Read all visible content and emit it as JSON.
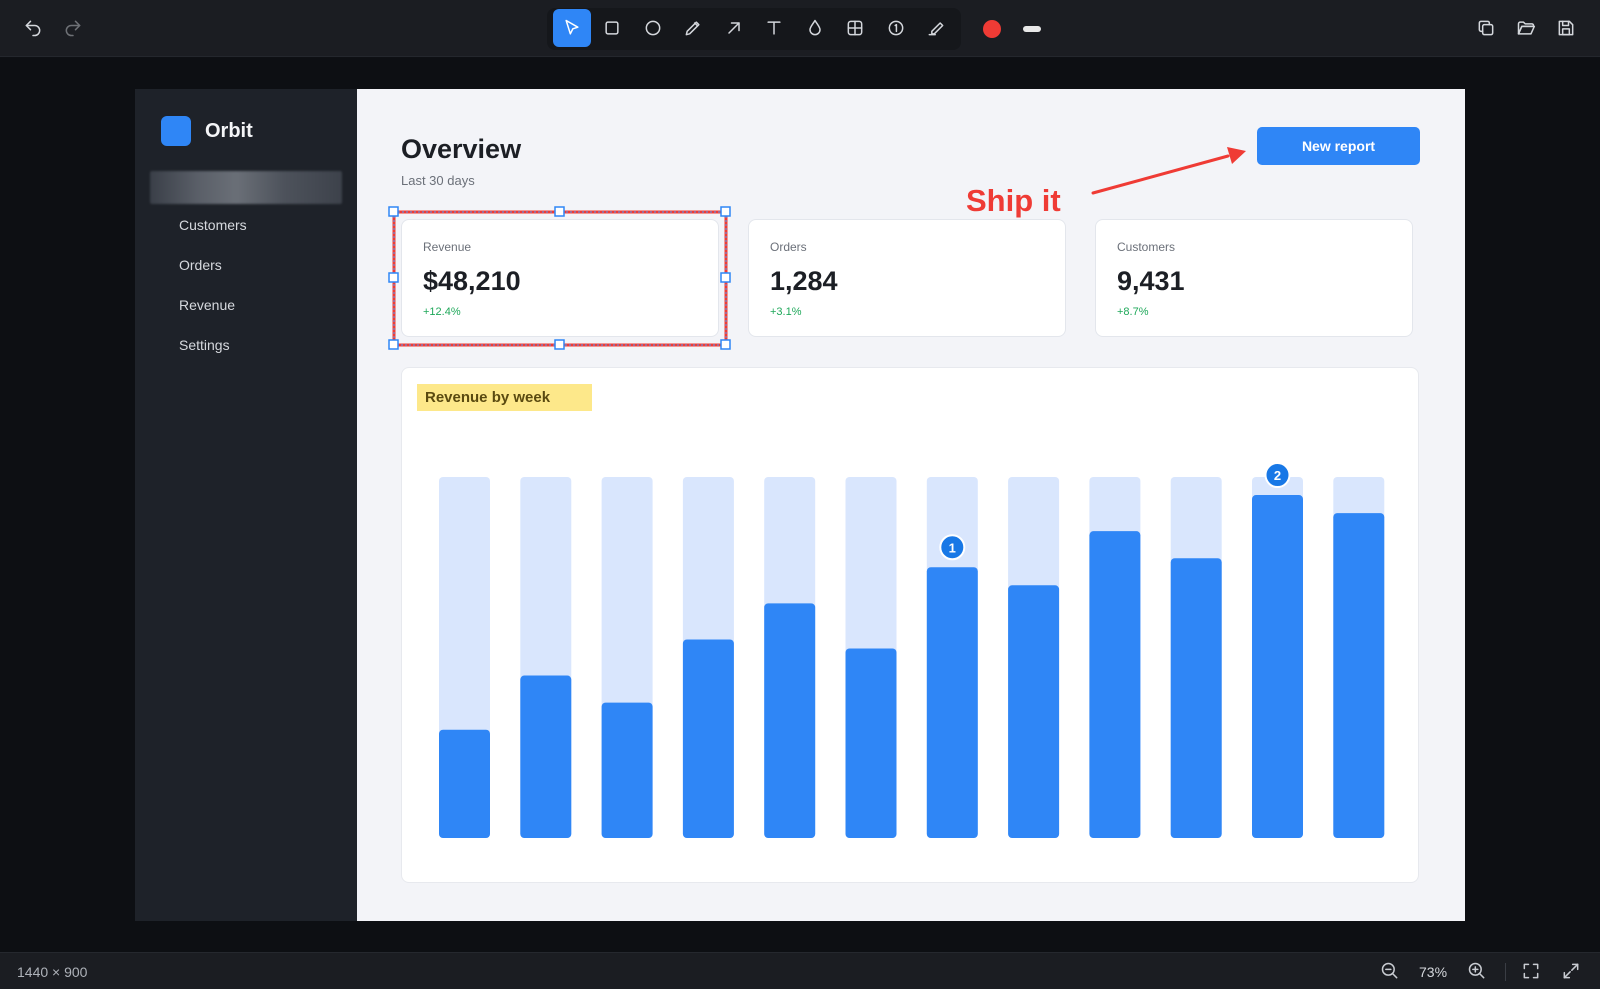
{
  "editor": {
    "tools": [
      {
        "name": "select",
        "active": true
      },
      {
        "name": "rectangle"
      },
      {
        "name": "ellipse"
      },
      {
        "name": "pen"
      },
      {
        "name": "arrow"
      },
      {
        "name": "text"
      },
      {
        "name": "blur"
      },
      {
        "name": "grid"
      },
      {
        "name": "step-counter"
      },
      {
        "name": "highlighter"
      }
    ],
    "stroke_color": "#ef3b35",
    "status": {
      "dimensions": "1440 × 900",
      "zoom": "73%"
    }
  },
  "app": {
    "logo": "Orbit",
    "nav": [
      "Customers",
      "Orders",
      "Revenue",
      "Settings"
    ],
    "title": "Overview",
    "subtitle": "Last 30 days",
    "new_report_label": "New report",
    "cards": [
      {
        "label": "Revenue",
        "value": "$48,210",
        "delta": "+12.4%"
      },
      {
        "label": "Orders",
        "value": "1,284",
        "delta": "+3.1%"
      },
      {
        "label": "Customers",
        "value": "9,431",
        "delta": "+8.7%"
      }
    ],
    "chart_title": "Revenue by week"
  },
  "annotations": {
    "text": "Ship it",
    "steps": [
      "1",
      "2"
    ]
  },
  "chart_data": {
    "type": "bar",
    "title": "Revenue by week",
    "values": [
      0.3,
      0.45,
      0.375,
      0.55,
      0.65,
      0.525,
      0.75,
      0.7,
      0.85,
      0.775,
      0.95,
      0.9
    ],
    "ylim": [
      0,
      1
    ],
    "colors": {
      "bar": "#2f86f6",
      "track": "#d9e6fd"
    }
  }
}
